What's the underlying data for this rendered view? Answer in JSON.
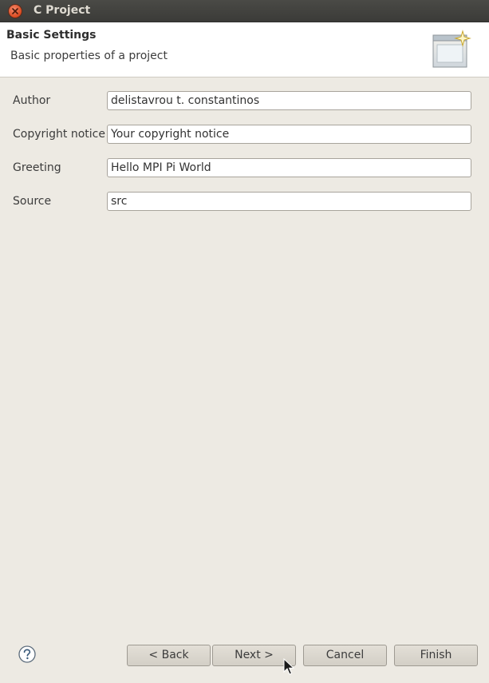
{
  "window": {
    "title": "C Project"
  },
  "header": {
    "title": "Basic Settings",
    "description": "Basic properties of a project"
  },
  "form": {
    "fields": [
      {
        "label": "Author",
        "value": "delistavrou t. constantinos"
      },
      {
        "label": "Copyright notice",
        "value": "Your copyright notice"
      },
      {
        "label": "Greeting",
        "value": "Hello MPI Pi World"
      },
      {
        "label": "Source",
        "value": "src"
      }
    ]
  },
  "footer": {
    "help_icon": "question-circle-icon",
    "back_label": "< Back",
    "next_label": "Next >",
    "cancel_label": "Cancel",
    "finish_label": "Finish"
  },
  "colors": {
    "background": "#edeae3",
    "titlebar": "#3c3b37",
    "close_button": "#e0562c",
    "header_background": "#ffffff"
  }
}
